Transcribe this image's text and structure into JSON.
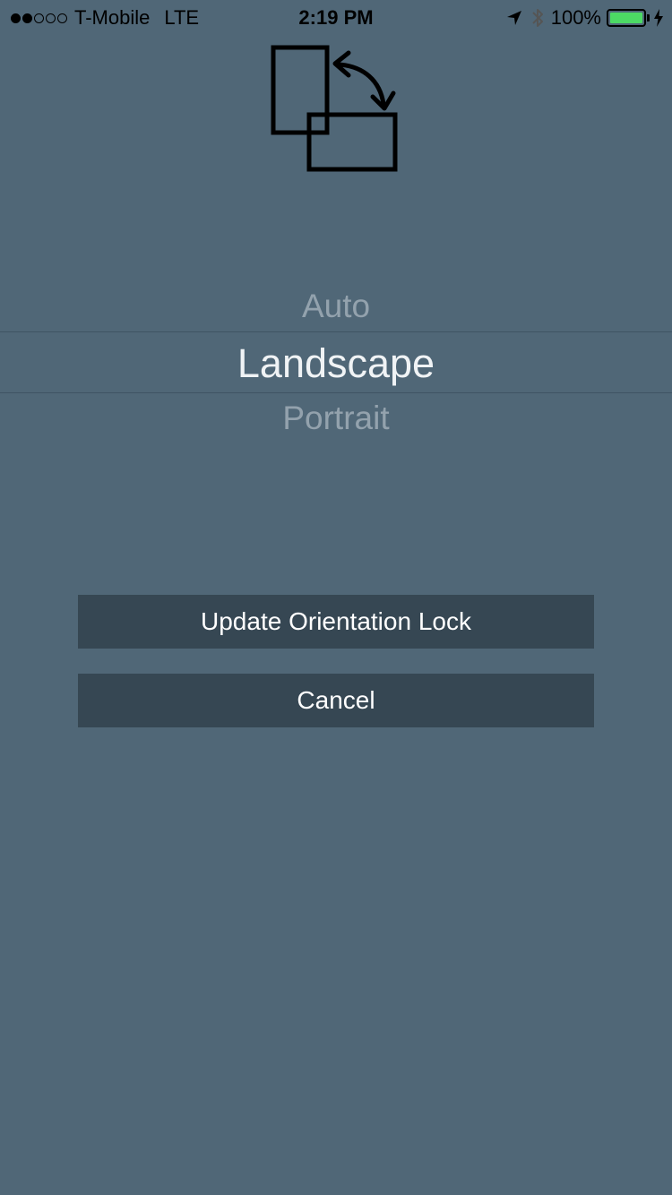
{
  "status_bar": {
    "carrier": "T-Mobile",
    "network": "LTE",
    "time": "2:19 PM",
    "battery": "100%",
    "signal_strength": 2,
    "signal_max": 5,
    "icons": [
      "location-arrow-icon",
      "bluetooth-icon",
      "battery-icon",
      "charging-bolt-icon"
    ],
    "battery_color": "#4cd964"
  },
  "header": {
    "icon": "rotate-orientation-icon"
  },
  "picker": {
    "options": [
      "Auto",
      "Landscape",
      "Portrait"
    ],
    "selected": "Landscape"
  },
  "buttons": {
    "update": "Update Orientation Lock",
    "cancel": "Cancel"
  },
  "colors": {
    "background": "#506777",
    "button": "#364753",
    "selected_text": "#f0f3f5",
    "dim_text": "#93a2ad"
  }
}
